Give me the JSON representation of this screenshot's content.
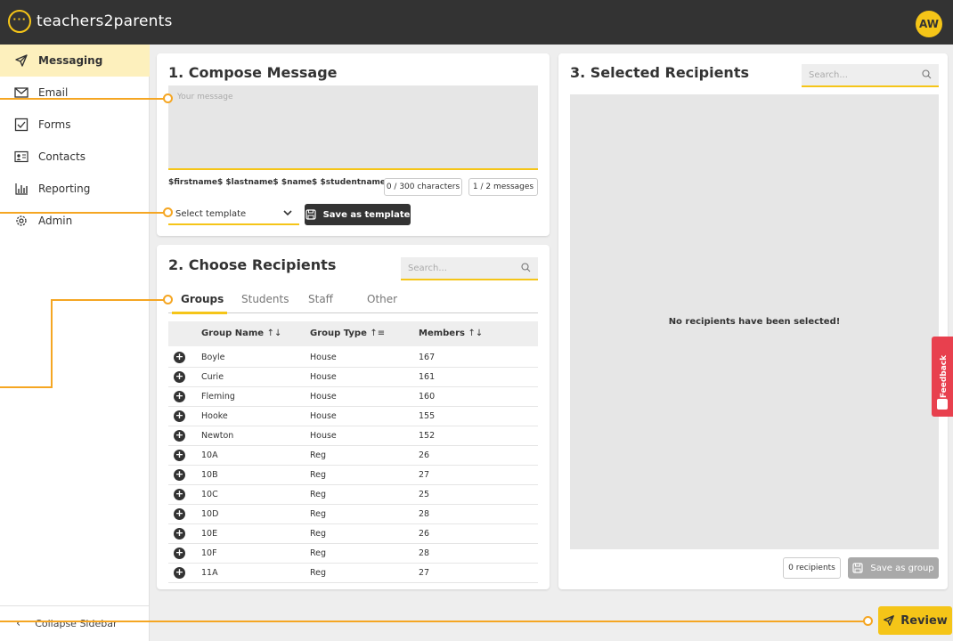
{
  "app": {
    "logo_text": "teachers2parents",
    "logo_mark": "···",
    "avatar": "AW",
    "accent": "#f5c518"
  },
  "sidebar": {
    "items": [
      {
        "label": "Messaging",
        "icon": "send-icon",
        "active": true
      },
      {
        "label": "Email",
        "icon": "mail-icon"
      },
      {
        "label": "Forms",
        "icon": "checkbox-icon"
      },
      {
        "label": "Contacts",
        "icon": "contact-card-icon"
      },
      {
        "label": "Reporting",
        "icon": "bar-chart-icon"
      },
      {
        "label": "Admin",
        "icon": "gear-icon"
      }
    ],
    "collapse_label": "Collapse Sidebar"
  },
  "compose": {
    "title": "1. Compose Message",
    "message_placeholder": "Your message",
    "variables": "$firstname$ $lastname$ $name$ $studentname$",
    "char_count": "0 / 300 characters",
    "msg_count": "1 / 2 messages",
    "template_select": "Select template",
    "save_template": "Save as template"
  },
  "recipients": {
    "title": "2. Choose Recipients",
    "search_placeholder": "Search...",
    "tabs": [
      "Groups",
      "Students",
      "Staff",
      "Other"
    ],
    "columns": [
      "Group Name",
      "Group Type",
      "Members"
    ],
    "rows": [
      {
        "name": "Boyle",
        "type": "House",
        "members": "167"
      },
      {
        "name": "Curie",
        "type": "House",
        "members": "161"
      },
      {
        "name": "Fleming",
        "type": "House",
        "members": "160"
      },
      {
        "name": "Hooke",
        "type": "House",
        "members": "155"
      },
      {
        "name": "Newton",
        "type": "House",
        "members": "152"
      },
      {
        "name": "10A",
        "type": "Reg",
        "members": "26"
      },
      {
        "name": "10B",
        "type": "Reg",
        "members": "27"
      },
      {
        "name": "10C",
        "type": "Reg",
        "members": "25"
      },
      {
        "name": "10D",
        "type": "Reg",
        "members": "28"
      },
      {
        "name": "10E",
        "type": "Reg",
        "members": "26"
      },
      {
        "name": "10F",
        "type": "Reg",
        "members": "28"
      },
      {
        "name": "11A",
        "type": "Reg",
        "members": "27"
      }
    ]
  },
  "selected": {
    "title": "3. Selected Recipients",
    "search_placeholder": "Search...",
    "empty_message": "No recipients have been selected!",
    "count": "0 recipients",
    "save_group": "Save as group"
  },
  "review_label": "Review",
  "feedback_label": "Feedback"
}
